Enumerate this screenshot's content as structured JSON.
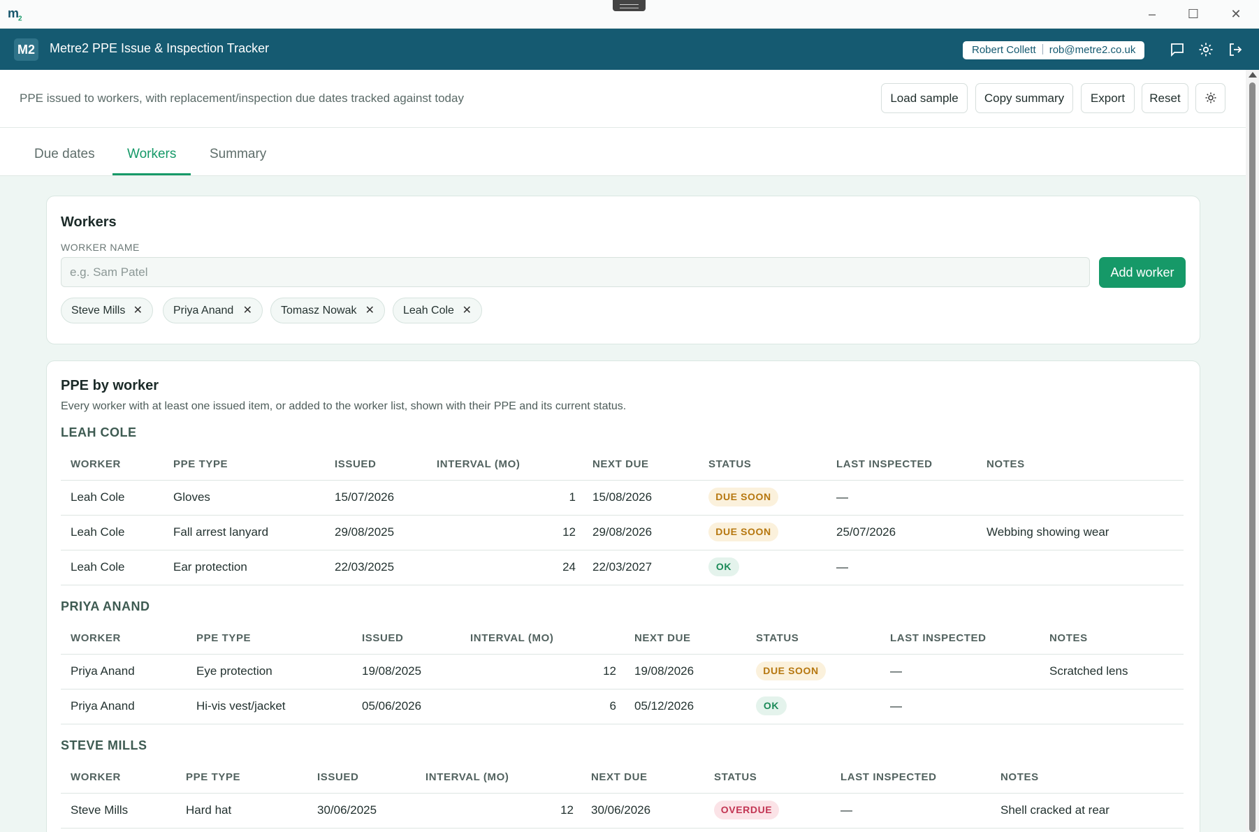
{
  "app": {
    "logo": "m2",
    "badge": "M2",
    "title": "Metre2 PPE Issue & Inspection Tracker",
    "user_name": "Robert Collett",
    "user_email": "rob@metre2.co.uk"
  },
  "toolbar": {
    "description": "PPE issued to workers, with replacement/inspection due dates tracked against today",
    "load_sample": "Load sample",
    "copy_summary": "Copy summary",
    "export": "Export",
    "reset": "Reset"
  },
  "tabs": [
    {
      "label": "Due dates",
      "active": false
    },
    {
      "label": "Workers",
      "active": true
    },
    {
      "label": "Summary",
      "active": false
    }
  ],
  "workers_card": {
    "title": "Workers",
    "field_label": "WORKER NAME",
    "placeholder": "e.g. Sam Patel",
    "add_button": "Add worker",
    "chips": [
      "Steve Mills",
      "Priya Anand",
      "Tomasz Nowak",
      "Leah Cole"
    ]
  },
  "ppe_card": {
    "title": "PPE by worker",
    "subtitle": "Every worker with at least one issued item, or added to the worker list, shown with their PPE and its current status.",
    "columns": [
      "WORKER",
      "PPE TYPE",
      "ISSUED",
      "INTERVAL (MO)",
      "NEXT DUE",
      "STATUS",
      "LAST INSPECTED",
      "NOTES"
    ],
    "groups": [
      {
        "name": "LEAH COLE",
        "rows": [
          {
            "worker": "Leah Cole",
            "type": "Gloves",
            "issued": "15/07/2026",
            "interval": "1",
            "next_due": "15/08/2026",
            "status": "DUE SOON",
            "last_inspected": "—",
            "notes": ""
          },
          {
            "worker": "Leah Cole",
            "type": "Fall arrest lanyard",
            "issued": "29/08/2025",
            "interval": "12",
            "next_due": "29/08/2026",
            "status": "DUE SOON",
            "last_inspected": "25/07/2026",
            "notes": "Webbing showing wear"
          },
          {
            "worker": "Leah Cole",
            "type": "Ear protection",
            "issued": "22/03/2025",
            "interval": "24",
            "next_due": "22/03/2027",
            "status": "OK",
            "last_inspected": "—",
            "notes": ""
          }
        ]
      },
      {
        "name": "PRIYA ANAND",
        "rows": [
          {
            "worker": "Priya Anand",
            "type": "Eye protection",
            "issued": "19/08/2025",
            "interval": "12",
            "next_due": "19/08/2026",
            "status": "DUE SOON",
            "last_inspected": "—",
            "notes": "Scratched lens"
          },
          {
            "worker": "Priya Anand",
            "type": "Hi-vis vest/jacket",
            "issued": "05/06/2026",
            "interval": "6",
            "next_due": "05/12/2026",
            "status": "OK",
            "last_inspected": "—",
            "notes": ""
          }
        ]
      },
      {
        "name": "STEVE MILLS",
        "rows": [
          {
            "worker": "Steve Mills",
            "type": "Hard hat",
            "issued": "30/06/2025",
            "interval": "12",
            "next_due": "30/06/2026",
            "status": "OVERDUE",
            "last_inspected": "—",
            "notes": "Shell cracked at rear"
          }
        ]
      }
    ]
  },
  "colors": {
    "header": "#155a71",
    "accent": "#169968",
    "due_soon": "#b6770f",
    "ok": "#1b8a58",
    "overdue": "#c23553"
  }
}
